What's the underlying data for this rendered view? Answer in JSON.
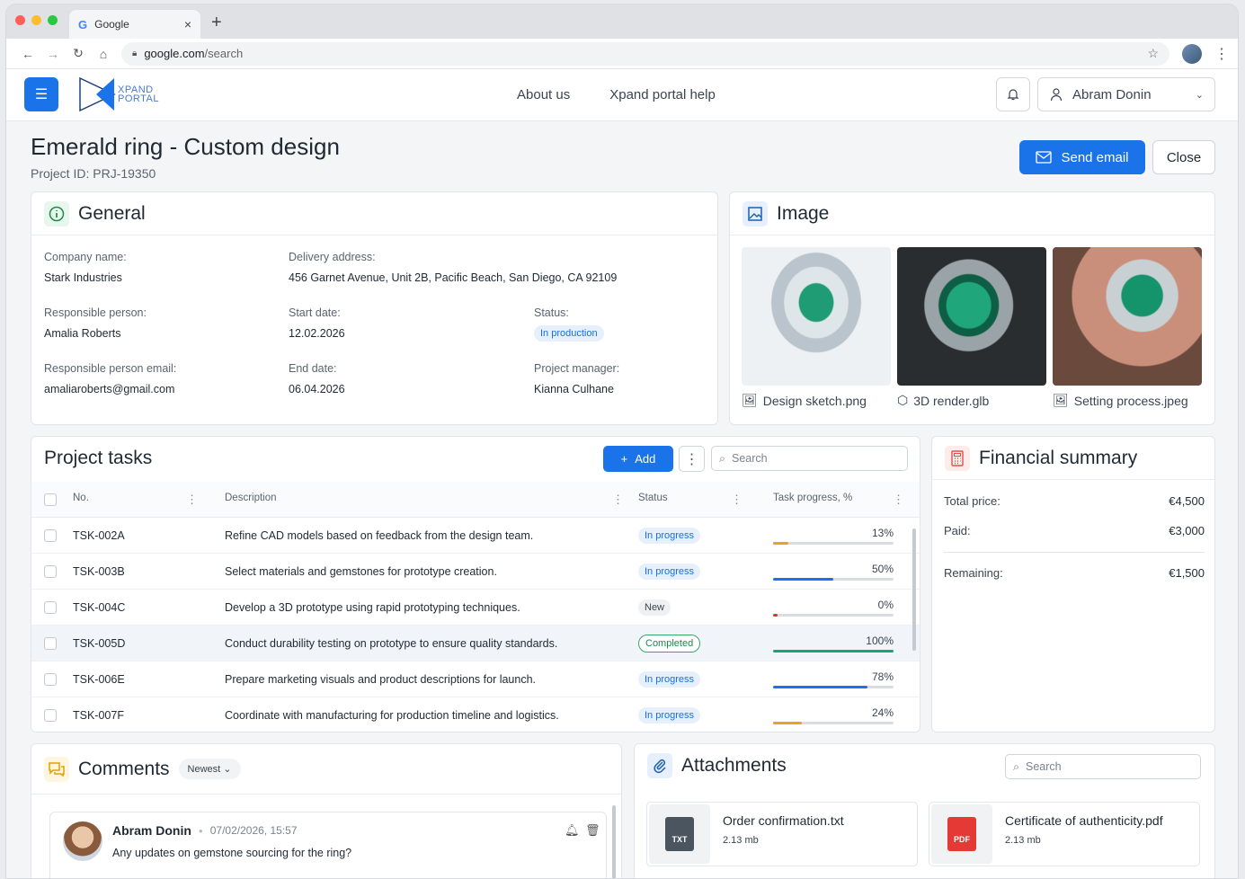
{
  "browser": {
    "tab_title": "Google",
    "url_host": "google.com",
    "url_path": "/search",
    "traffic_colors": [
      "#ff5f57",
      "#febc2e",
      "#28c840"
    ]
  },
  "header": {
    "logo_line1": "XPAND",
    "logo_line2": "PORTAL",
    "nav": [
      "About us",
      "Xpand portal help"
    ],
    "user_name": "Abram Donin"
  },
  "page": {
    "title": "Emerald ring - Custom design",
    "project_id": "Project ID: PRJ-19350",
    "send_email_label": "Send email",
    "close_label": "Close"
  },
  "general": {
    "title": "General",
    "company_label": "Company name:",
    "company": "Stark Industries",
    "delivery_label": "Delivery address:",
    "delivery": "456 Garnet Avenue, Unit 2B, Pacific Beach, San Diego, CA 92109",
    "responsible_label": "Responsible person:",
    "responsible": "Amalia Roberts",
    "start_label": "Start date:",
    "start": "12.02.2026",
    "status_label": "Status:",
    "status": "In production",
    "email_label": "Responsible person email:",
    "email": "amaliaroberts@gmail.com",
    "end_label": "End date:",
    "end": "06.04.2026",
    "manager_label": "Project manager:",
    "manager": "Kianna Culhane"
  },
  "image": {
    "title": "Image",
    "items": [
      {
        "caption": "Design sketch.png",
        "icon": "image-icon"
      },
      {
        "caption": "3D render.glb",
        "icon": "cube-icon"
      },
      {
        "caption": "Setting process.jpeg",
        "icon": "image-icon"
      }
    ]
  },
  "tasks": {
    "title": "Project tasks",
    "add_label": "Add",
    "search_placeholder": "Search",
    "headers": {
      "no": "No.",
      "desc": "Description",
      "status": "Status",
      "progress": "Task progress, %"
    },
    "rows": [
      {
        "no": "TSK-002A",
        "desc": "Refine CAD models based on feedback from the design team.",
        "status": "In progress",
        "pct_label": "13%",
        "progress": 13,
        "color": "#f0a01e"
      },
      {
        "no": "TSK-003B",
        "desc": "Select materials and gemstones for prototype creation.",
        "status": "In progress",
        "pct_label": "50%",
        "progress": 50,
        "color": "#1a73e8"
      },
      {
        "no": "TSK-004C",
        "desc": "Develop a 3D prototype using rapid prototyping techniques.",
        "status": "New",
        "pct_label": "0%",
        "progress": 0,
        "color": "#e03131"
      },
      {
        "no": "TSK-005D",
        "desc": "Conduct durability testing on prototype to ensure quality standards.",
        "status": "Completed",
        "pct_label": "100%",
        "progress": 100,
        "color": "#17a673"
      },
      {
        "no": "TSK-006E",
        "desc": "Prepare marketing visuals and product descriptions for launch.",
        "status": "In progress",
        "pct_label": "78%",
        "progress": 78,
        "color": "#1a73e8"
      },
      {
        "no": "TSK-007F",
        "desc": "Coordinate with manufacturing for production timeline and logistics.",
        "status": "In progress",
        "pct_label": "24%",
        "progress": 24,
        "color": "#f0a01e"
      }
    ]
  },
  "financial": {
    "title": "Financial summary",
    "total_label": "Total price:",
    "total": "€4,500",
    "paid_label": "Paid:",
    "paid": "€3,000",
    "remaining_label": "Remaining:",
    "remaining": "€1,500"
  },
  "comments": {
    "title": "Comments",
    "sort": "Newest",
    "author": "Abram Donin",
    "time": "07/02/2026, 15:57",
    "text": "Any updates on gemstone sourcing for the ring?"
  },
  "attachments": {
    "title": "Attachments",
    "search_placeholder": "Search",
    "files": [
      {
        "name": "Order confirmation.txt",
        "size": "2.13 mb",
        "type": "TXT"
      },
      {
        "name": "Certificate of authenticity.pdf",
        "size": "2.13 mb",
        "type": "PDF"
      }
    ]
  }
}
